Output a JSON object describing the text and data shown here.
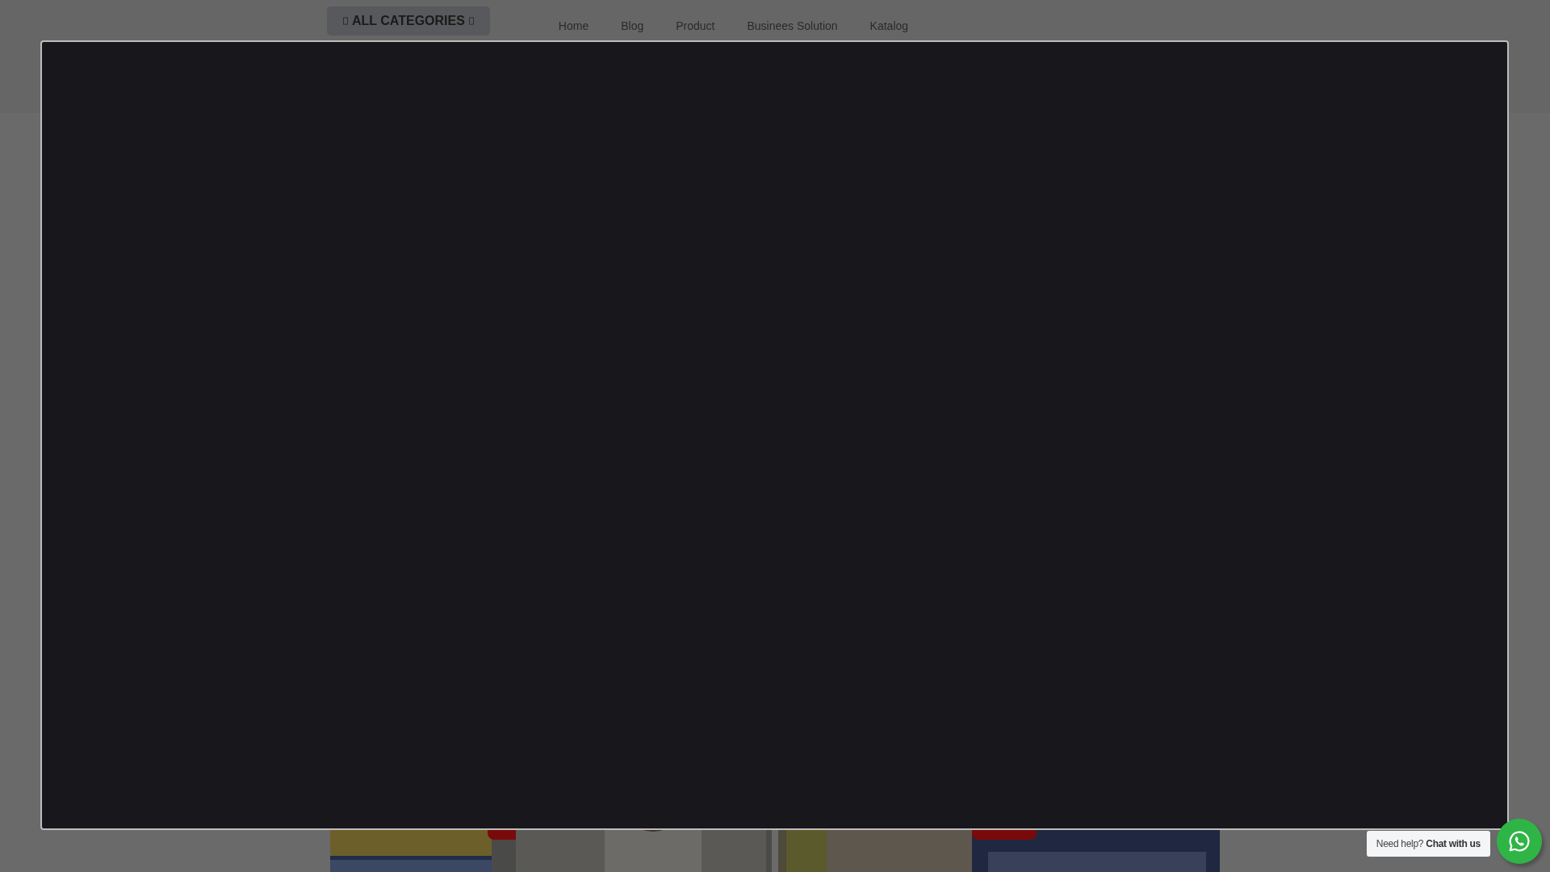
{
  "nav": {
    "categories_button": "ALL CATEGORIES",
    "links": [
      "Home",
      "Blog",
      "Product",
      "Businees Solution",
      "Katalog"
    ]
  },
  "chat_widget": {
    "prompt": "Need help? **Chat with us**"
  }
}
